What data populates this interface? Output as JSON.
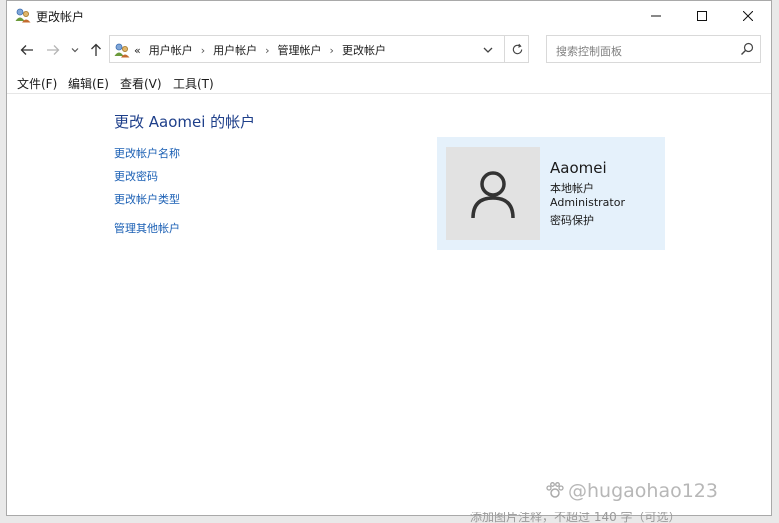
{
  "window": {
    "title": "更改帐户"
  },
  "address_bar": {
    "overflow": "«",
    "breadcrumbs": [
      "用户帐户",
      "用户帐户",
      "管理帐户",
      "更改帐户"
    ]
  },
  "search": {
    "placeholder": "搜索控制面板"
  },
  "menu": {
    "items": [
      "文件(F)",
      "编辑(E)",
      "查看(V)",
      "工具(T)"
    ]
  },
  "content": {
    "heading": "更改 Aaomei 的帐户",
    "tasks": [
      "更改帐户名称",
      "更改密码",
      "更改帐户类型",
      "管理其他帐户"
    ]
  },
  "account": {
    "name": "Aaomei",
    "type": "本地帐户",
    "role": "Administrator",
    "protection": "密码保护"
  },
  "watermark": {
    "text": "@hugaohao123",
    "partial_text": "添加图片注释，不超过 140 字（可选）"
  },
  "colors": {
    "link": "#1a5fb4",
    "heading": "#1e3f8a",
    "card_bg": "#e5f1fb"
  }
}
